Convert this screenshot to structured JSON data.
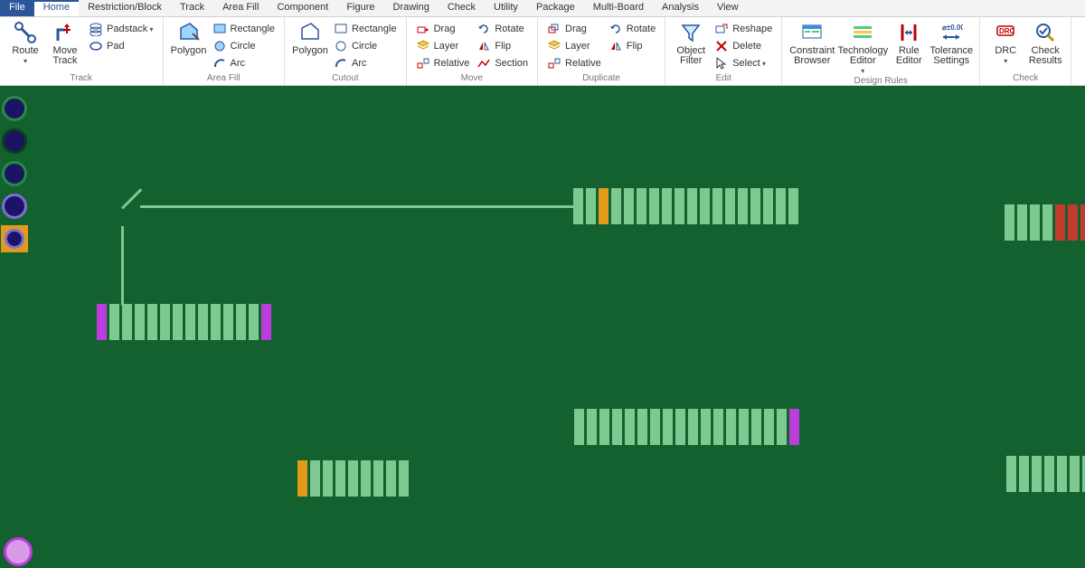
{
  "menu": {
    "file": "File",
    "home": "Home",
    "restrict": "Restriction/Block",
    "track": "Track",
    "areafill": "Area Fill",
    "component": "Component",
    "figure": "Figure",
    "drawing": "Drawing",
    "check": "Check",
    "utility": "Utility",
    "package": "Package",
    "multiboard": "Multi-Board",
    "analysis": "Analysis",
    "view": "View"
  },
  "groups": {
    "track": "Track",
    "areafill": "Area Fill",
    "cutout": "Cutout",
    "move": "Move",
    "duplicate": "Duplicate",
    "edit": "Edit",
    "designrules": "Design Rules",
    "check": "Check"
  },
  "btn": {
    "route": "Route",
    "movetrack": "Move\nTrack",
    "padstack": "Padstack",
    "pad": "Pad",
    "polygon": "Polygon",
    "rectangle": "Rectangle",
    "circle": "Circle",
    "arc": "Arc",
    "drag": "Drag",
    "rotate": "Rotate",
    "layer": "Layer",
    "flip": "Flip",
    "relative": "Relative",
    "section": "Section",
    "objectfilter": "Object\nFilter",
    "reshape": "Reshape",
    "delete": "Delete",
    "select": "Select",
    "constraintbrowser": "Constraint\nBrowser",
    "techeditor": "Technology\nEditor",
    "ruleeditor": "Rule\nEditor",
    "tolerancesettings": "Tolerance\nSettings",
    "drc": "DRC",
    "checkresults": "Check\nResults"
  },
  "colors": {
    "board": "#13612f",
    "padGreen": "#7ec98f",
    "padOrange": "#e39a1a",
    "padMagenta": "#bc3ddc",
    "padRed": "#c13c2e",
    "holeFill": "#1b1464",
    "accent": "#2b579a"
  }
}
